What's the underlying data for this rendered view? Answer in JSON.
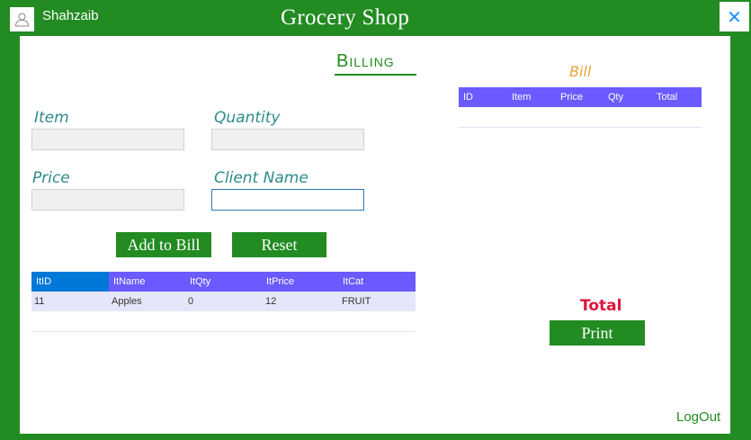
{
  "header": {
    "user_name": "Shahzaib",
    "app_title": "Grocery Shop",
    "close_glyph": "✕"
  },
  "billing": {
    "title": "Billing",
    "labels": {
      "item": "Item",
      "quantity": "Quantity",
      "price": "Price",
      "client_name": "Client Name"
    },
    "inputs": {
      "item": "",
      "quantity": "",
      "price": "",
      "client_name": ""
    },
    "buttons": {
      "add_to_bill": "Add to Bill",
      "reset": "Reset"
    }
  },
  "items_table": {
    "columns": [
      "ItID",
      "ItName",
      "ItQty",
      "ItPrice",
      "ItCat"
    ],
    "rows": [
      [
        "11",
        "Apples",
        "0",
        "12",
        "FRUIT"
      ]
    ]
  },
  "bill": {
    "title": "Bill",
    "columns": [
      "ID",
      "Item",
      "Price",
      "Qty",
      "Total"
    ],
    "total_label": "Total",
    "print_label": "Print"
  },
  "footer": {
    "logout": "LogOut"
  },
  "colors": {
    "brand_green": "#228B22",
    "header_purple": "#6A5AFF",
    "selected_blue": "#0078D7",
    "total_red": "#DC143C",
    "bill_orange": "#E8A33A"
  },
  "icons": {
    "user": "user-icon",
    "close": "close-icon"
  }
}
